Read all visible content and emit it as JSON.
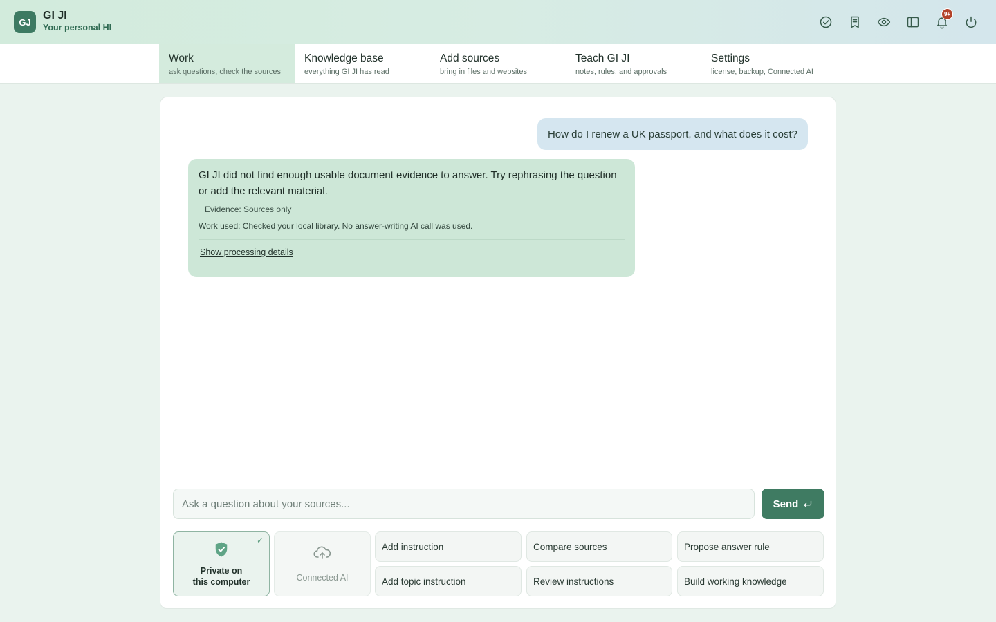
{
  "header": {
    "logo": "GJ",
    "title": "GI JI",
    "subtitle": "Your personal HI",
    "notification_count": "9+",
    "icons": [
      "check-circle-icon",
      "notebook-icon",
      "eye-icon",
      "sidebar-icon",
      "bell-icon",
      "power-icon"
    ]
  },
  "tabs": [
    {
      "label": "Work",
      "desc": "ask questions, check the sources",
      "active": true
    },
    {
      "label": "Knowledge base",
      "desc": "everything GI JI has read",
      "active": false
    },
    {
      "label": "Add sources",
      "desc": "bring in files and websites",
      "active": false
    },
    {
      "label": "Teach GI JI",
      "desc": "notes, rules, and approvals",
      "active": false
    },
    {
      "label": "Settings",
      "desc": "license, backup, Connected AI",
      "active": false
    }
  ],
  "chat": {
    "user_message": "How do I renew a UK passport, and what does it cost?",
    "bot_message": "GI JI did not find enough usable document evidence to answer. Try rephrasing the question or add the relevant material.",
    "evidence": "Evidence: Sources only",
    "work_used": "Work used: Checked your local library. No answer-writing AI call was used.",
    "details_link": "Show processing details"
  },
  "input": {
    "placeholder": "Ask a question about your sources...",
    "value": "",
    "send_label": "Send"
  },
  "modes": {
    "private": {
      "line1": "Private on",
      "line2": "this computer",
      "selected": true
    },
    "connected": {
      "label": "Connected AI",
      "selected": false
    }
  },
  "actions": {
    "add_instruction": "Add instruction",
    "compare_sources": "Compare sources",
    "propose_answer_rule": "Propose answer rule",
    "add_topic_instruction": "Add topic instruction",
    "review_instructions": "Review instructions",
    "build_working_knowledge": "Build working knowledge"
  },
  "colors": {
    "accent": "#3f7b62",
    "tab_active": "#d4ebdd",
    "user_bubble": "#d5e6f0",
    "bot_bubble": "#cde7d7",
    "badge": "#b3432a"
  }
}
